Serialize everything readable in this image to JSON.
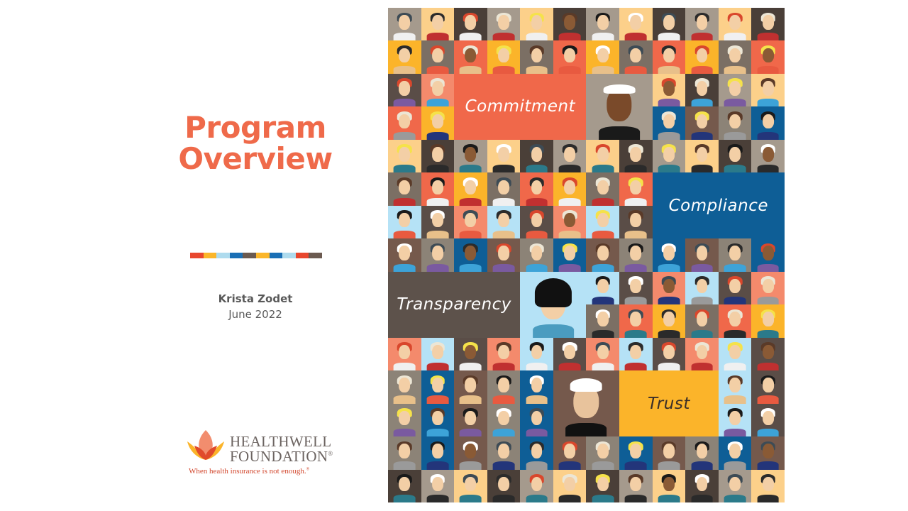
{
  "slide": {
    "title_line1": "Program",
    "title_line2": "Overview",
    "author": "Krista Zodet",
    "date": "June 2022",
    "accent_color": "#ef6a4a",
    "stripe_colors": [
      "#e8472e",
      "#fbb62a",
      "#aedbee",
      "#1a6fb5",
      "#6b5a50",
      "#fbb62a",
      "#1a6fb5",
      "#aedbee",
      "#e8472e",
      "#6b5a50"
    ]
  },
  "logo": {
    "name_line1": "HEALTHWELL",
    "name_line2": "FOUNDATION",
    "registered": "®",
    "tagline": "When health insurance is not enough.",
    "tagline_mark": "®"
  },
  "mosaic": {
    "features": [
      {
        "label": "Commitment",
        "color": "#f0684a",
        "text_color": "#ffffff"
      },
      {
        "label": "Compliance",
        "color": "#0e5e96",
        "text_color": "#ffffff"
      },
      {
        "label": "Transparency",
        "color": "#5d524b",
        "text_color": "#ffffff"
      },
      {
        "label": "Trust",
        "color": "#fbb42a",
        "text_color": "#3a2e28"
      }
    ],
    "palette": [
      "#a59a8d",
      "#7b6f64",
      "#b5e2f6",
      "#75594c",
      "#4a3f38",
      "#fbb42a",
      "#f48a6c",
      "#0e5e96",
      "#fcd08a",
      "#f0684a",
      "#5a4d47",
      "#8c8377"
    ],
    "hair_palette": [
      "#1a1a1a",
      "#2b2b2b",
      "#f5e24a",
      "#ffffff",
      "#d9472c",
      "#5a3a28",
      "#3d4b55",
      "#ece6d5"
    ],
    "body_palette": [
      "#2b7a8a",
      "#e8c08a",
      "#23357a",
      "#c03030",
      "#7a5aa0",
      "#2a2a2a",
      "#e85a40",
      "#9a9a9a",
      "#f0f0f0",
      "#3da3d8"
    ]
  }
}
